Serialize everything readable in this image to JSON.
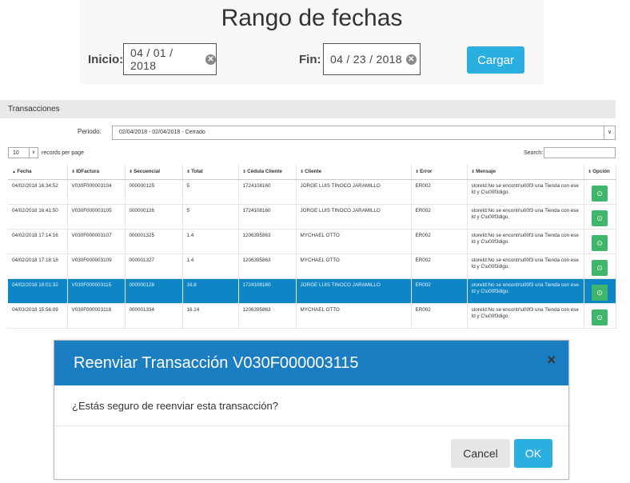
{
  "date_range": {
    "title": "Rango de fechas",
    "inicio_label": "Inicio:",
    "inicio_value": "04 / 01 / 2018",
    "fin_label": "Fin:",
    "fin_value": "04 / 23 / 2018",
    "cargar_label": "Cargar"
  },
  "transactions": {
    "header": "Transacciones",
    "periodo_label": "Periodo:",
    "periodo_value": "02/04/2018 - 02/04/2018 - Cerrado",
    "records_value": "10",
    "records_label": "records per page",
    "search_label": "Search:",
    "columns": [
      "Fecha",
      "IDFactura",
      "Secuencial",
      "Total",
      "Cédula Cliente",
      "Cliente",
      "Error",
      "Mensaje",
      "Opción"
    ],
    "rows": [
      {
        "fecha": "04/02/2018 16:34:52",
        "id": "V030F000003104",
        "sec": "000000125",
        "total": "5",
        "cedula": "1724108160",
        "cliente": "JORGE LUIS TINOCO JARAMILLO",
        "error": "ER002",
        "mensaje": "storeId:No se encontr\\u00f3 una Tienda con ese Id y C\\u00f3digo."
      },
      {
        "fecha": "04/02/2018 16:41:50",
        "id": "V030F000003105",
        "sec": "000000126",
        "total": "5",
        "cedula": "1724108160",
        "cliente": "JORGE LUIS TINOCO JARAMILLO",
        "error": "ER002",
        "mensaje": "storeId:No se encontr\\u00f3 una Tienda con ese Id y C\\u00f3digo."
      },
      {
        "fecha": "04/02/2018 17:14:16",
        "id": "V030F000003107",
        "sec": "000001325",
        "total": "1.4",
        "cedula": "1206395863",
        "cliente": "MYCHAEL OTTO",
        "error": "ER002",
        "mensaje": "storeId:No se encontr\\u00f3 una Tienda con ese Id y C\\u00f3digo."
      },
      {
        "fecha": "04/02/2018 17:18:18",
        "id": "V030F000003109",
        "sec": "000001327",
        "total": "1.4",
        "cedula": "1206395863",
        "cliente": "MYCHAEL OTTO",
        "error": "ER002",
        "mensaje": "storeId:No se encontr\\u00f3 una Tienda con ese Id y C\\u00f3digo."
      },
      {
        "fecha": "04/02/2018 18:01:32",
        "id": "V030F000003115",
        "sec": "000000128",
        "total": "16.8",
        "cedula": "1724108160",
        "cliente": "JORGE LUIS TINOCO JARAMILLO",
        "error": "ER002",
        "mensaje": "storeId:No se encontr\\u00f3 una Tienda con ese Id y C\\u00f3digo.",
        "selected": true
      },
      {
        "fecha": "04/03/2018 15:56:09",
        "id": "V030F000003118",
        "sec": "000001334",
        "total": "16.14",
        "cedula": "1206395863",
        "cliente": "MYCHAEL OTTO",
        "error": "ER002",
        "mensaje": "storeId:No se encontr\\u00f3 una Tienda con ese Id y C\\u00f3digo."
      }
    ]
  },
  "modal": {
    "title": "Reenviar Transacción V030F000003115",
    "close": "×",
    "body": "¿Estás seguro de reenviar esta transacción?",
    "cancel_label": "Cancel",
    "ok_label": "OK"
  },
  "colors": {
    "accent": "#2baee0",
    "modal_header": "#1b7ec2",
    "selected_row": "#0e86c6",
    "option_button": "#3fb66b"
  }
}
